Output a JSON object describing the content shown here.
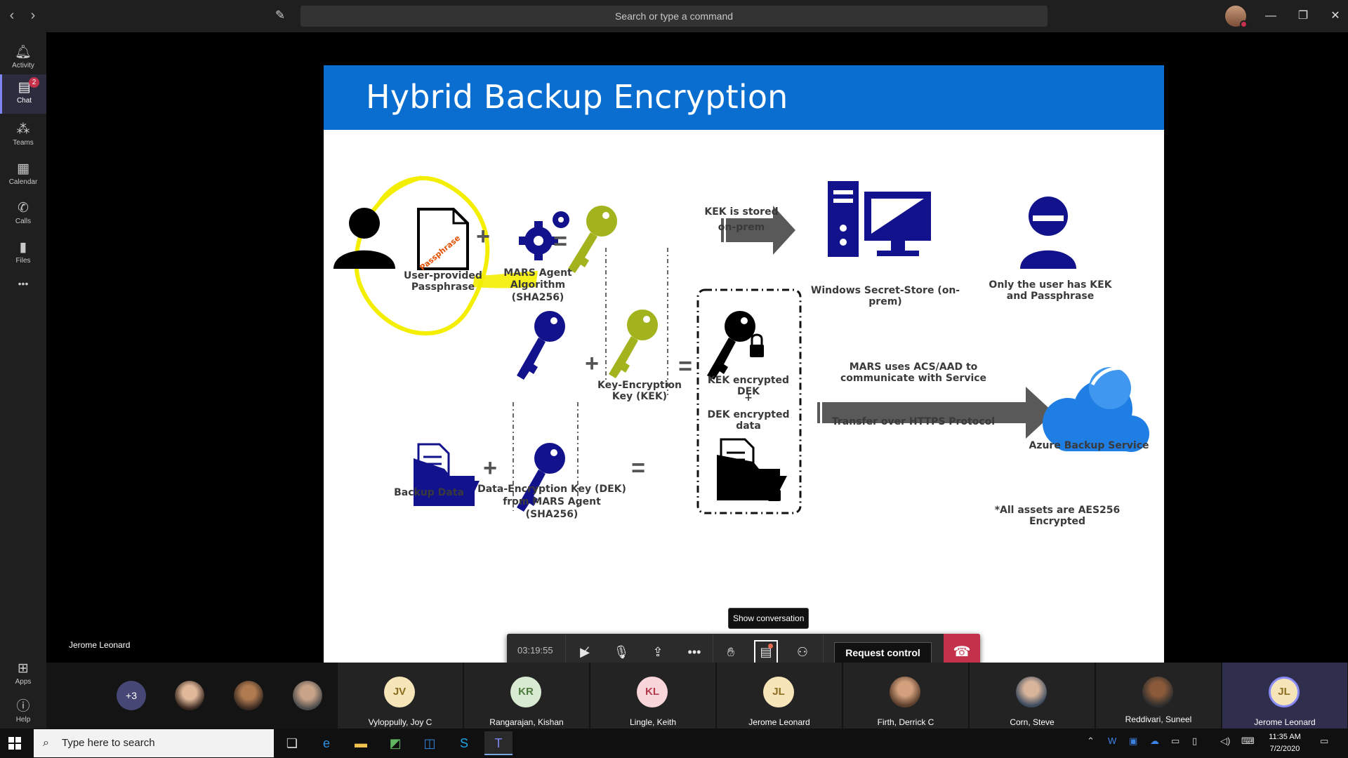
{
  "titlebar": {
    "search_placeholder": "Search or type a command"
  },
  "rail": {
    "activity": "Activity",
    "chat": "Chat",
    "chat_badge": "2",
    "teams": "Teams",
    "calendar": "Calendar",
    "calls": "Calls",
    "files": "Files",
    "more": "•••",
    "apps": "Apps",
    "help": "Help"
  },
  "slide": {
    "title": "Hybrid Backup Encryption",
    "passphrase_stamp": "Passphrase",
    "user_passphrase": "User-provided\nPassphrase",
    "mars_algo_line1": "MARS Agent",
    "mars_algo_line2": "Algorithm",
    "mars_algo_line3": "(SHA256)",
    "kek_stored": "KEK is stored\non-prem",
    "secret_store": "Windows Secret-Store (on-prem)",
    "only_user": "Only the user has KEK\nand Passphrase",
    "kek_label": "Key-Encryption\nKey (KEK)",
    "kek_encrypted": "KEK encrypted DEK",
    "plus": "+",
    "dek_encrypted": "DEK encrypted data",
    "mars_uses": "MARS uses ACS/AAD to\ncommunicate with Service",
    "transfer": "Transfer over HTTPS Protocol",
    "azure": "Azure Backup Service",
    "backup_data": "Backup Data",
    "dek_label": "Data-Encryption Key (DEK)\nfrom MARS Agent\n(SHA256)",
    "aes_note": "*All assets are AES256 Encrypted"
  },
  "presenter": "Jerome Leonard",
  "controls": {
    "timer": "03:19:55",
    "tooltip": "Show conversation",
    "request_control": "Request control"
  },
  "participants": {
    "overflow": "+3",
    "tiles": [
      {
        "initials": "JV",
        "name": "Vyloppully, Joy C"
      },
      {
        "initials": "KR",
        "name": "Rangarajan, Kishan"
      },
      {
        "initials": "KL",
        "name": "Lingle, Keith"
      },
      {
        "initials": "JL",
        "name": "Jerome Leonard"
      },
      {
        "initials": "",
        "name": "Firth, Derrick C"
      },
      {
        "initials": "",
        "name": "Corn, Steve"
      },
      {
        "initials": "",
        "name": "Reddivari, Suneel"
      },
      {
        "initials": "JL",
        "name": "Jerome Leonard"
      }
    ]
  },
  "taskbar": {
    "search_placeholder": "Type here to search",
    "time": "11:35 AM",
    "date": "7/2/2020"
  },
  "colors": {
    "slide_header": "#0a6ed1",
    "navy": "#12128c",
    "olive": "#a3b31d",
    "highlight": "#f4ee00",
    "hangup": "#c4314b",
    "teams_accent": "#7f85f5"
  }
}
